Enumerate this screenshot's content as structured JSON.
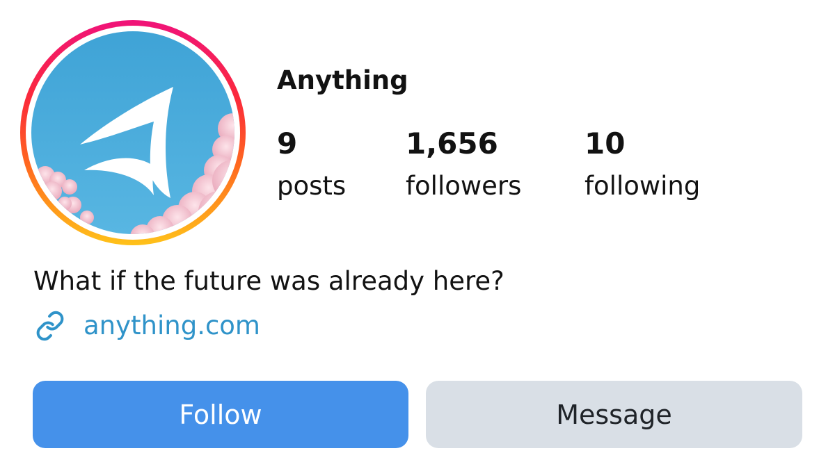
{
  "profile": {
    "username": "Anything",
    "bio": "What if the future was already here?",
    "link": "anything.com",
    "avatar_icon": "arrowhead-logo-on-sky",
    "ring_colors": [
      "#f0137a",
      "#fb2a3a",
      "#ff6a1f",
      "#ffc21a"
    ]
  },
  "stats": {
    "posts": {
      "value": "9",
      "label": "posts"
    },
    "followers": {
      "value": "1,656",
      "label": "followers"
    },
    "following": {
      "value": "10",
      "label": "following"
    }
  },
  "actions": {
    "follow_label": "Follow",
    "message_label": "Message"
  },
  "colors": {
    "follow_button": "#4591ea",
    "message_button": "#d9dfe6",
    "link": "#2f93c9",
    "text": "#121212"
  },
  "icons": {
    "link": "link-icon"
  }
}
